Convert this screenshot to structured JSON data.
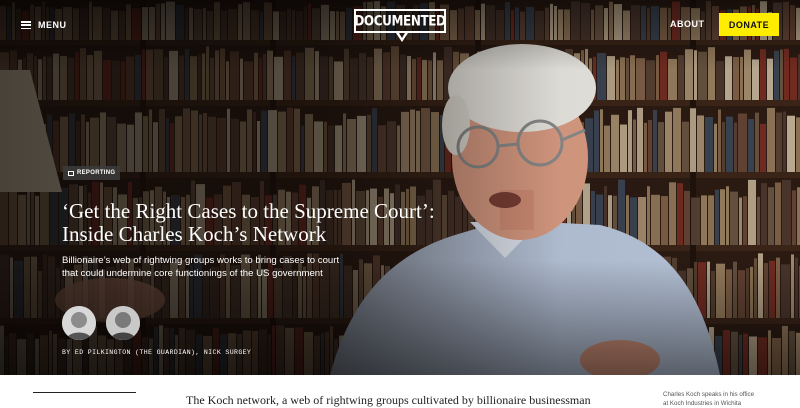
{
  "nav": {
    "menu_label": "MENU",
    "logo_text": "DOCUMENTED",
    "about_label": "ABOUT",
    "donate_label": "DONATE"
  },
  "article": {
    "section_tag": "REPORTING",
    "headline_line1": "‘Get the Right Cases to the Supreme Court’:",
    "headline_line2": "Inside Charles Koch’s Network",
    "dek": "Billionaire’s web of rightwing groups works to bring cases to court that could undermine core functionings of the US government",
    "byline": "BY ED PILKINGTON (THE GUARDIAN), NICK SURGEY",
    "body_start": "The Koch network, a web of rightwing groups cultivated by billionaire businessman",
    "photo_caption_line1": "Charles Koch speaks in his office",
    "photo_caption_line2": "at Koch Industries in Wichita"
  },
  "colors": {
    "donate_bg": "#ffed00",
    "hero_bg": "#241712"
  },
  "icons": {
    "menu": "hamburger-icon",
    "tag": "tag-icon"
  }
}
